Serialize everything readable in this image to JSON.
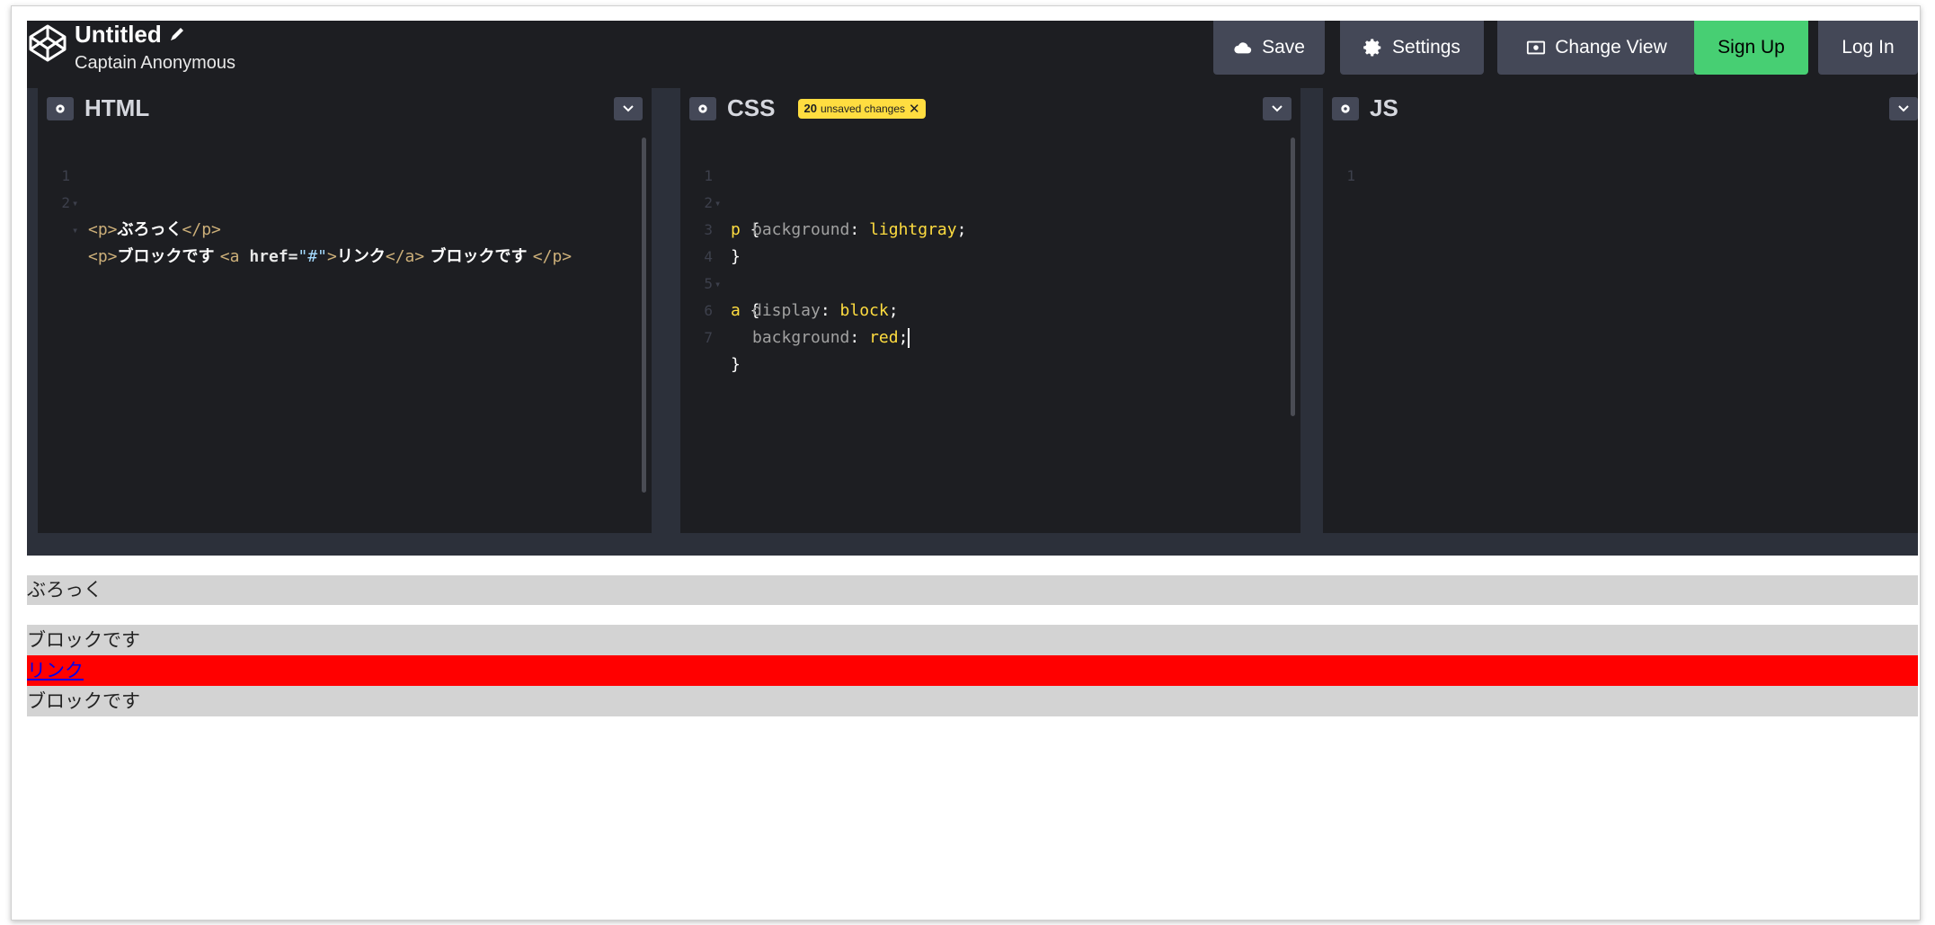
{
  "header": {
    "title": "Untitled",
    "owner": "Captain Anonymous",
    "buttons": {
      "save": "Save",
      "settings": "Settings",
      "change_view": "Change View",
      "sign_up": "Sign Up",
      "log_in": "Log In"
    }
  },
  "editors": {
    "html": {
      "title": "HTML",
      "lines": [
        {
          "n": "1",
          "open": "<p>",
          "text": "ぶろっく",
          "close": "</p>"
        },
        {
          "n": "2",
          "open": "<p>",
          "text": "ブロックです ",
          "a_open": "<a ",
          "attr": "href=",
          "str": "\"#\"",
          "a_gt": ">",
          "link": "リンク",
          "a_close": "</a>",
          "text2": " ブロックです ",
          "close": "</p>"
        }
      ]
    },
    "css": {
      "title": "CSS",
      "badge": "20 unsaved changes",
      "badge_count": "20",
      "badge_text": "unsaved changes",
      "lines": [
        {
          "n": "1",
          "sel": "p",
          "punc": " {"
        },
        {
          "n": "2",
          "prop": "background",
          "colon": ": ",
          "val": "lightgray",
          "semi": ";"
        },
        {
          "n": "3",
          "punc": "}"
        },
        {
          "n": "4",
          "sel": "a",
          "punc": " {"
        },
        {
          "n": "5",
          "prop": "display",
          "colon": ": ",
          "val": "block",
          "semi": ";"
        },
        {
          "n": "6",
          "prop": "background",
          "colon": ": ",
          "val": "red",
          "semi": ";"
        },
        {
          "n": "7",
          "punc": "}"
        }
      ]
    },
    "js": {
      "title": "JS",
      "lines": [
        {
          "n": "1"
        }
      ]
    }
  },
  "preview": {
    "p1": "ぶろっく",
    "p2_before": "ブロックです",
    "p2_link": "リンク",
    "p2_after": "ブロックです"
  },
  "colors": {
    "background": "#1d1e22",
    "button": "#444857",
    "signup": "#47cf73",
    "badge": "#ffdd40",
    "lightgray": "#d3d3d3",
    "red": "#ff0000"
  },
  "icons": [
    "codepen-logo-icon",
    "pencil-icon",
    "cloud-icon",
    "gear-icon",
    "view-icon",
    "chevron-down-icon",
    "close-icon"
  ]
}
